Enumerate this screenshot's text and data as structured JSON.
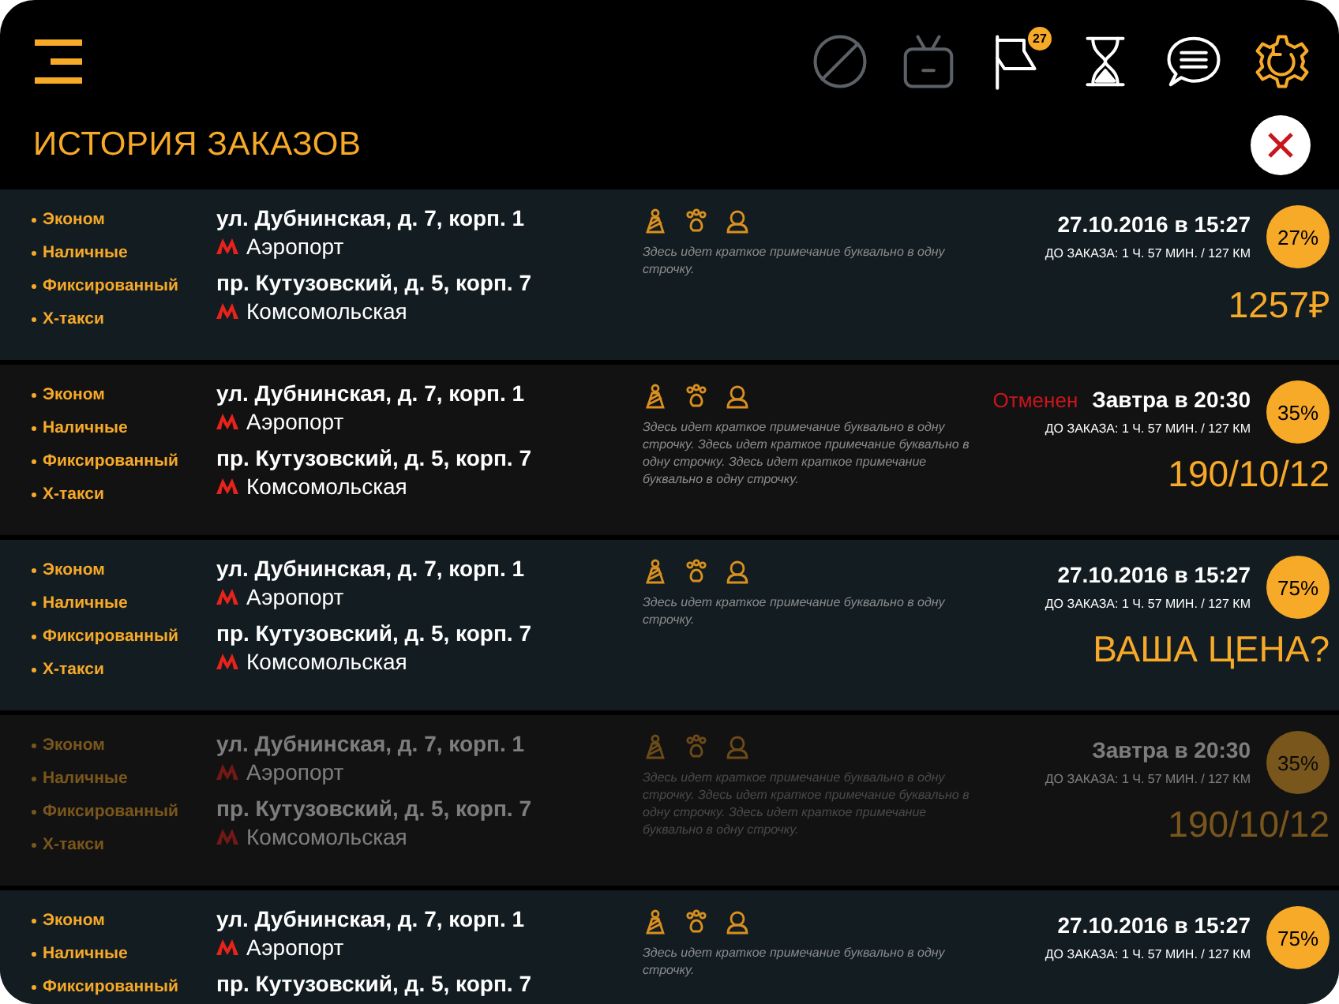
{
  "toolbar": [
    {
      "kind": "no-sign",
      "disabled": true,
      "selected": false
    },
    {
      "kind": "robot",
      "disabled": true,
      "selected": false
    },
    {
      "kind": "flag",
      "disabled": false,
      "selected": false,
      "badge": "27"
    },
    {
      "kind": "hourglass",
      "disabled": false,
      "selected": false
    },
    {
      "kind": "chat",
      "disabled": false,
      "selected": false
    },
    {
      "kind": "gear",
      "disabled": false,
      "selected": true
    }
  ],
  "title": "ИСТОРИЯ ЗАКАЗОВ",
  "orders": [
    {
      "faded": false,
      "tags": [
        "Эконом",
        "Наличные",
        "Фиксированный",
        "Х-такси"
      ],
      "route": [
        {
          "address": "ул. Дубнинская, д. 7, корп. 1",
          "metro": "Аэропорт"
        },
        {
          "address": "пр. Кутузовский, д. 5, корп. 7",
          "metro": "Комсомольская"
        }
      ],
      "note": "Здесь идет краткое примечание буквально в одну строчку.",
      "when": "27.10.2016 в 15:27",
      "eta": "ДО ЗАКАЗА: 1 Ч. 57 МИН. / 127 КМ",
      "percent": "27%",
      "price": "1257₽"
    },
    {
      "faded": false,
      "status": "Отменен",
      "tags": [
        "Эконом",
        "Наличные",
        "Фиксированный",
        "Х-такси"
      ],
      "route": [
        {
          "address": "ул. Дубнинская, д. 7, корп. 1",
          "metro": "Аэропорт"
        },
        {
          "address": "пр. Кутузовский, д. 5, корп. 7",
          "metro": "Комсомольская"
        }
      ],
      "note": "Здесь идет краткое примечание буквально в одну строчку. Здесь идет краткое примечание буквально в одну строчку. Здесь идет краткое примечание буквально в одну строчку.",
      "when": "Завтра в 20:30",
      "eta": "ДО ЗАКАЗА: 1 Ч. 57 МИН. / 127 КМ",
      "percent": "35%",
      "price": "190/10/12"
    },
    {
      "faded": false,
      "tags": [
        "Эконом",
        "Наличные",
        "Фиксированный",
        "Х-такси"
      ],
      "route": [
        {
          "address": "ул. Дубнинская, д. 7, корп. 1",
          "metro": "Аэропорт"
        },
        {
          "address": "пр. Кутузовский, д. 5, корп. 7",
          "metro": "Комсомольская"
        }
      ],
      "note": "Здесь идет краткое примечание буквально в одну строчку.",
      "when": "27.10.2016 в 15:27",
      "eta": "ДО ЗАКАЗА: 1 Ч. 57 МИН. / 127 КМ",
      "percent": "75%",
      "price": "ВАША ЦЕНА?"
    },
    {
      "faded": true,
      "tags": [
        "Эконом",
        "Наличные",
        "Фиксированный",
        "Х-такси"
      ],
      "route": [
        {
          "address": "ул. Дубнинская, д. 7, корп. 1",
          "metro": "Аэропорт"
        },
        {
          "address": "пр. Кутузовский, д. 5, корп. 7",
          "metro": "Комсомольская"
        }
      ],
      "note": "Здесь идет краткое примечание буквально в одну строчку. Здесь идет краткое примечание буквально в одну строчку. Здесь идет краткое примечание буквально в одну строчку.",
      "when": "Завтра в 20:30",
      "eta": "ДО ЗАКАЗА: 1 Ч. 57 МИН. / 127 КМ",
      "percent": "35%",
      "price": "190/10/12"
    },
    {
      "faded": false,
      "tags": [
        "Эконом",
        "Наличные",
        "Фиксированный"
      ],
      "route": [
        {
          "address": "ул. Дубнинская, д. 7, корп. 1",
          "metro": "Аэропорт"
        },
        {
          "address": "пр. Кутузовский, д. 5, корп. 7"
        }
      ],
      "note": "Здесь идет краткое примечание буквально в одну строчку.",
      "when": "27.10.2016 в 15:27",
      "eta": "ДО ЗАКАЗА: 1 Ч. 57 МИН. / 127 КМ",
      "percent": "75%"
    }
  ]
}
